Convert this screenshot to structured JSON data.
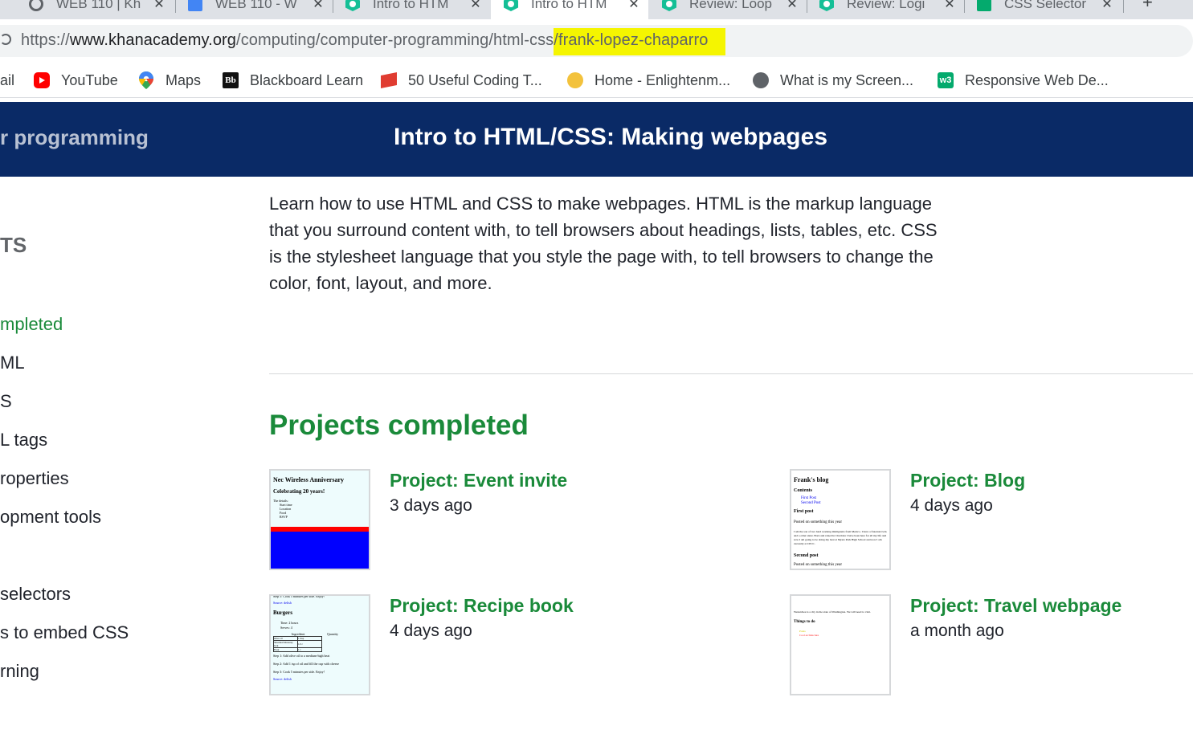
{
  "tabs": [
    {
      "title": "WEB 110 | Kh",
      "icon": "globe-icon",
      "active": false
    },
    {
      "title": "WEB 110 - W",
      "icon": "google-docs-icon",
      "active": false
    },
    {
      "title": "Intro to HTM",
      "icon": "khan-academy-icon",
      "active": false
    },
    {
      "title": "Intro to HTM",
      "icon": "khan-academy-icon",
      "active": true
    },
    {
      "title": "Review: Loop",
      "icon": "khan-academy-icon",
      "active": false
    },
    {
      "title": "Review: Logi",
      "icon": "khan-academy-icon",
      "active": false
    },
    {
      "title": "CSS Selector",
      "icon": "w3schools-icon",
      "active": false
    }
  ],
  "address": {
    "proto": "https://",
    "host": "www.khanacademy.org",
    "path": "/computing/computer-programming/html-css",
    "highlighted": "/frank-lopez-chaparro",
    "highlight_color": "#f5f500"
  },
  "bookmarks": [
    {
      "label": "ail",
      "icon": ""
    },
    {
      "label": "YouTube",
      "icon": "youtube-icon"
    },
    {
      "label": "Maps",
      "icon": "maps-pin-icon"
    },
    {
      "label": "Blackboard Learn",
      "icon": "blackboard-icon",
      "icon_text": "Bb"
    },
    {
      "label": "50 Useful Coding T...",
      "icon": "coding-tips-icon"
    },
    {
      "label": "Home - Enlightenm...",
      "icon": "enlightenment-icon"
    },
    {
      "label": "What is my Screen...",
      "icon": "globe-icon"
    },
    {
      "label": "Responsive Web De...",
      "icon": "w3schools-icon",
      "icon_text": "w3"
    }
  ],
  "header": {
    "breadcrumb": "r programming",
    "title": "Intro to HTML/CSS: Making webpages",
    "bg_color": "#0a2a66"
  },
  "sidebar": {
    "heading": "TS",
    "items": [
      {
        "label": "mpleted",
        "active": true
      },
      {
        "label": "ML",
        "active": false
      },
      {
        "label": "S",
        "active": false
      },
      {
        "label": "L tags",
        "active": false
      },
      {
        "label": "roperties",
        "active": false
      },
      {
        "label": "opment tools",
        "active": false
      },
      {
        "label": "selectors",
        "active": false
      },
      {
        "label": "s to embed CSS",
        "active": false
      },
      {
        "label": "rning",
        "active": false
      }
    ]
  },
  "main": {
    "description": "Learn how to use HTML and CSS to make webpages. HTML is the markup language that you surround content with, to tell browsers about headings, lists, tables, etc. CSS is the stylesheet language that you style the page with, to tell browsers to change the color, font, layout, and more.",
    "section_title": "Projects completed",
    "accent_color": "#1a8a3a",
    "projects": [
      {
        "title": "Project: Event invite",
        "time": "3 days ago",
        "thumb": {
          "heading": "Nec Wireless Anniversary",
          "subheading": "Celebrating 20 years!",
          "lines": [
            "The details:",
            "Start time",
            "Location",
            "Food",
            "RSVP"
          ]
        }
      },
      {
        "title": "Project: Blog",
        "time": "4 days ago",
        "thumb": {
          "heading": "Frank's blog",
          "contents": "Contents",
          "links": [
            "First Post",
            "Second Post"
          ],
          "post1": "First post",
          "post1_date": "Posted on something this year",
          "post1_body": "I am the son of two hard working immigrants from Mexico. I have a fraternal twin and a older sister. Born and raised in Charlotte I have been here for all my life and now I am going to be doing my best at Myers Park High School and now I am currently at CPCC.",
          "post2": "Second post",
          "post2_date": "Posted on something this year"
        }
      },
      {
        "title": "Project: Recipe book",
        "time": "4 days ago",
        "thumb": {
          "top": "Step 5: Cook 5 minutes per side. Enjoy!",
          "source1": "Source: delish",
          "heading": "Burgers",
          "meta": [
            "Time: 2 hours",
            "Serves: 4"
          ],
          "col_headers": [
            "Ingredient",
            "Quantity"
          ],
          "rows": [
            [
              "Olive oil",
              "1 tbsp"
            ],
            [
              "Shredded Monterey Jack",
              "1/2 c"
            ],
            [
              "Flour",
              "1 c"
            ]
          ],
          "steps": [
            "Step 1: Add olive oil to a medium-high heat",
            "Step 2: Add 1 tsp of oil and fill the cup with cheese",
            "Step 3: Cook 5 minutes per side. Enjoy!"
          ],
          "source2": "Source: delish"
        }
      },
      {
        "title": "Project: Travel webpage",
        "time": "a month ago",
        "thumb": {
          "intro": "Wenatchee is a city in the state of Washington. We will need to visit.",
          "heading": "Things to do",
          "items": [
            "Parks",
            "Cool architecture"
          ]
        }
      }
    ]
  }
}
